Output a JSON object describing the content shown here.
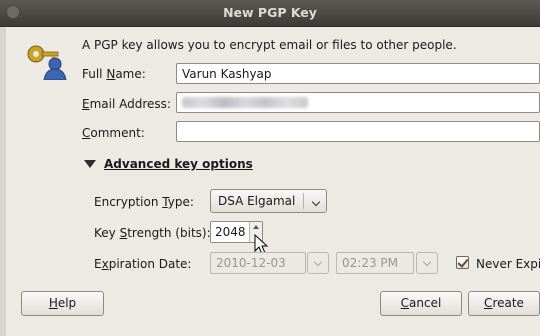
{
  "window": {
    "title": "New PGP Key"
  },
  "intro_text": "A PGP key allows you to encrypt email or files to other people.",
  "form": {
    "full_name": {
      "label_pre": "Full ",
      "label_u": "N",
      "label_post": "ame:",
      "value": "Varun Kashyap"
    },
    "email": {
      "label_pre": "",
      "label_u": "E",
      "label_post": "mail Address:",
      "value": ""
    },
    "comment": {
      "label_pre": "",
      "label_u": "C",
      "label_post": "omment:",
      "value": ""
    }
  },
  "advanced": {
    "title": "Advanced key options",
    "encryption_type": {
      "label_pre": "Encryption ",
      "label_u": "T",
      "label_post": "ype:",
      "value": "DSA Elgamal"
    },
    "key_strength": {
      "label_pre": "Key ",
      "label_u": "S",
      "label_post": "trength (bits):",
      "value": "2048"
    },
    "expiration": {
      "label_pre": "E",
      "label_u": "x",
      "label_post": "piration Date:",
      "date": "2010-12-03",
      "time": "02:23 PM",
      "never_expires_label": "Never Expire",
      "never_expires_checked": true
    }
  },
  "buttons": {
    "help": {
      "label_u": "H",
      "label_post": "elp"
    },
    "cancel": {
      "label_u": "C",
      "label_post": "ancel"
    },
    "create": {
      "label_u": "C",
      "label_post": "reate"
    }
  }
}
